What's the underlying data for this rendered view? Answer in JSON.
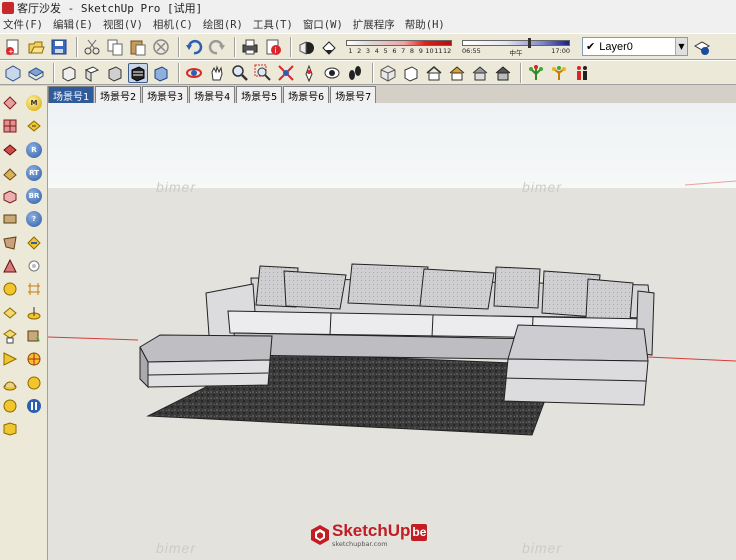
{
  "window": {
    "title": "客厅沙发 - SketchUp Pro [试用]"
  },
  "menu": [
    "文件(F)",
    "编辑(E)",
    "视图(V)",
    "相机(C)",
    "绘图(R)",
    "工具(T)",
    "窗口(W)",
    "扩展程序",
    "帮助(H)"
  ],
  "toolbar1": {
    "icons": [
      "new-file-icon",
      "open-file-icon",
      "save-icon",
      "cut-icon",
      "copy-icon",
      "paste-icon",
      "erase-icon",
      "undo-icon",
      "redo-icon",
      "print-icon",
      "model-info-icon",
      "camera-icon",
      "paint-icon"
    ],
    "month_ticks": [
      "1",
      "2",
      "3",
      "4",
      "5",
      "6",
      "7",
      "8",
      "9",
      "10",
      "11",
      "12"
    ],
    "time_start": "06:55",
    "time_mid": "中午",
    "time_end": "17:00",
    "layer_current": "Layer0",
    "layer_check": "✔"
  },
  "toolbar2": {
    "icons": [
      "iso-view-icon",
      "top-view-icon",
      "front-view-icon",
      "right-view-icon",
      "back-view-icon",
      "left-view-icon",
      "orbit-icon",
      "pan-icon",
      "zoom-icon",
      "zoom-window-icon",
      "zoom-extents-icon",
      "position-camera-icon",
      "look-around-icon",
      "walk-icon",
      "xray-icon",
      "wireframe-style-icon",
      "hidden-line-icon",
      "shaded-icon",
      "shaded-texture-icon",
      "monochrome-icon",
      "components-icon",
      "plant-icon",
      "people-icon"
    ]
  },
  "scenes": [
    "场景号1",
    "场景号2",
    "场景号3",
    "场景号4",
    "场景号5",
    "场景号6",
    "场景号7"
  ],
  "left_toolbar": {
    "col1": [
      "select-icon",
      "component-icon",
      "paint-bucket-icon",
      "eraser-icon",
      "rectangle-icon",
      "line-icon",
      "circle-icon",
      "arc-icon",
      "polygon-icon",
      "freehand-icon",
      "move-icon",
      "push-pull-icon",
      "rotate-icon",
      "follow-me-icon",
      "scale-icon",
      "offset-icon"
    ],
    "col2": [
      "M",
      "tape-measure-icon",
      "R",
      "RT",
      "BR",
      "?",
      "protractor-icon",
      "axes-icon",
      "dimension-icon",
      "text-icon",
      "3d-text-icon",
      "section-icon",
      "walk-icon",
      "pause-icon"
    ]
  },
  "watermark_text": "bimer",
  "brand": {
    "name": "SketchUp",
    "suffix": "be",
    "url": "sketchupbar.com"
  },
  "colors": {
    "selected_tab": "#2f5b9b",
    "red_axis": "#d83a3a",
    "brand_red": "#c21d22"
  }
}
